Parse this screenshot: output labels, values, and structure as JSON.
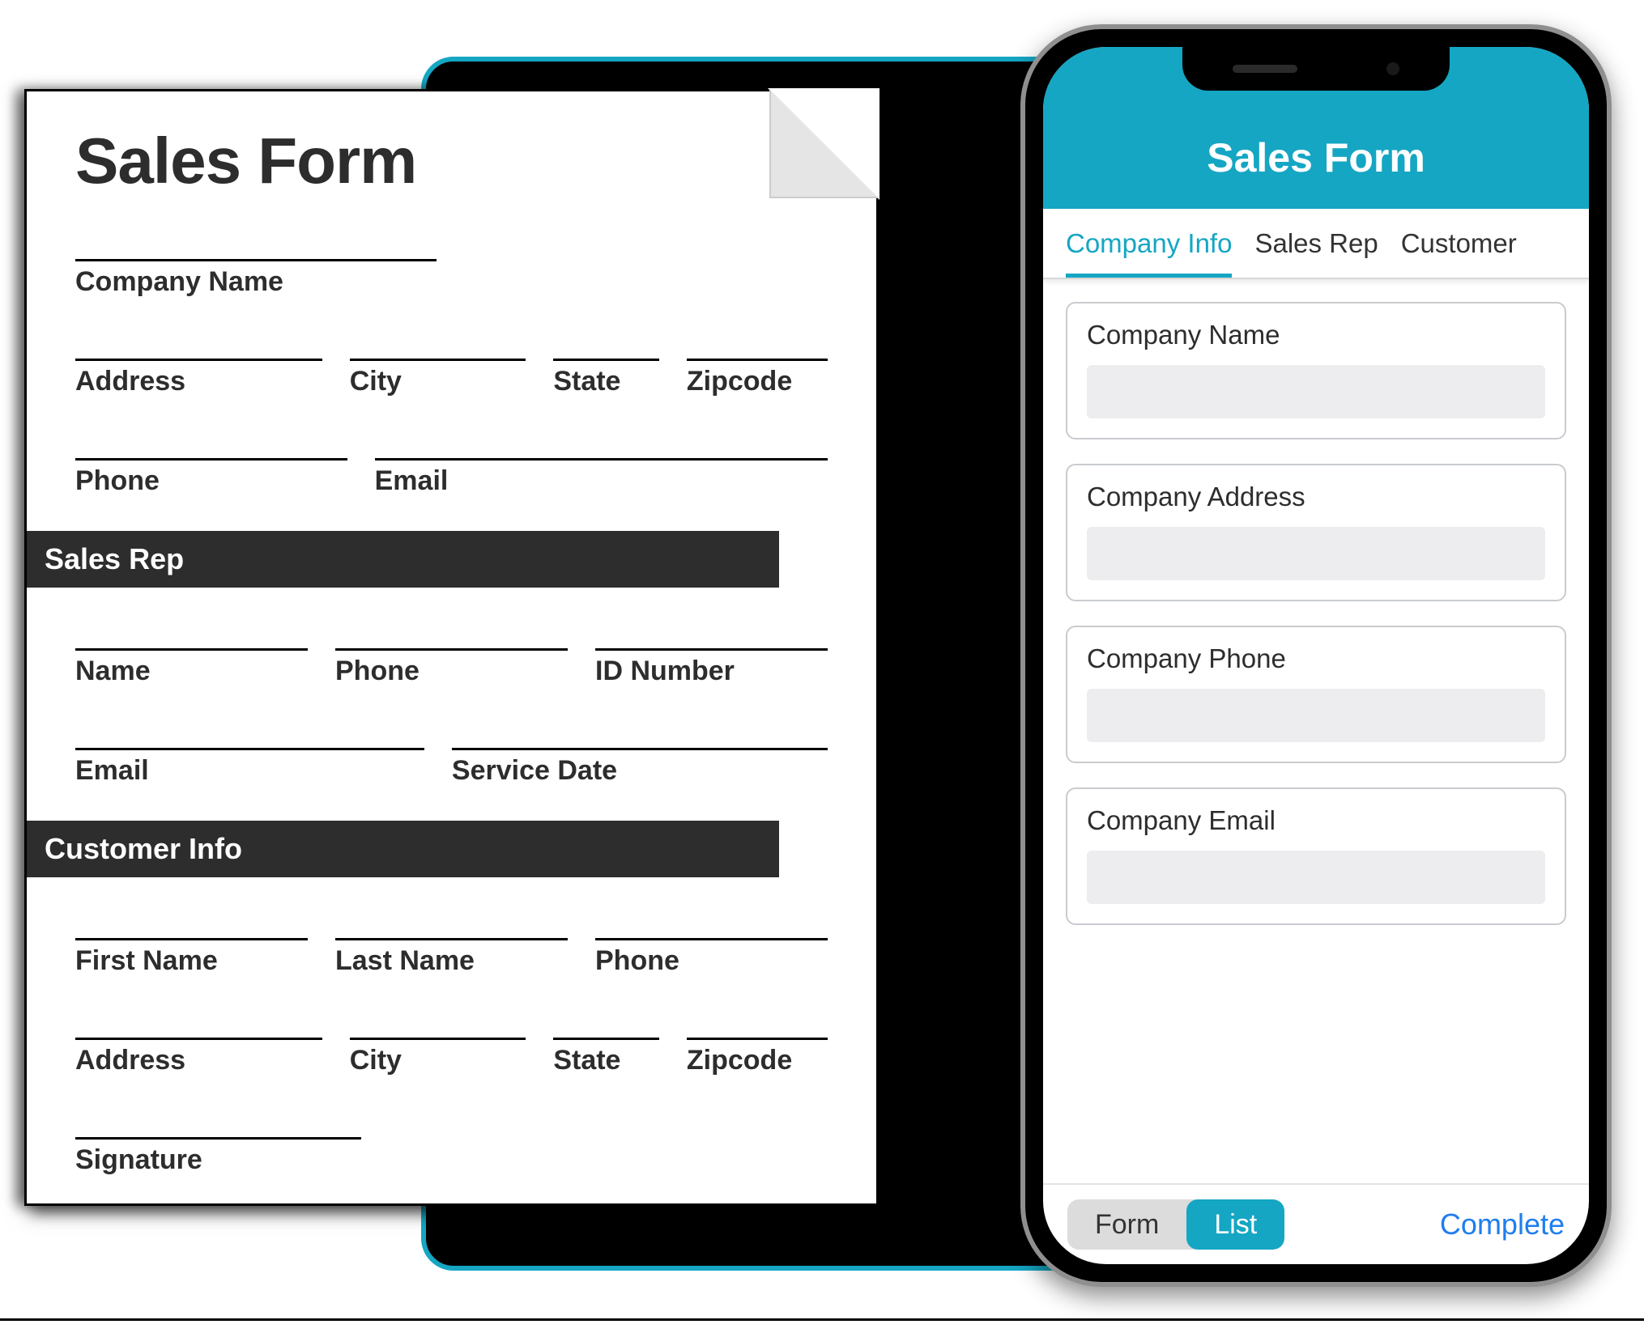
{
  "colors": {
    "accent": "#15a6c3",
    "ink": "#2d2d2d",
    "link": "#1e7ef0"
  },
  "paper": {
    "title": "Sales Form",
    "company_fields": {
      "company_name": "Company Name",
      "address": "Address",
      "city": "City",
      "state": "State",
      "zipcode": "Zipcode",
      "phone": "Phone",
      "email": "Email"
    },
    "section_sales_rep": "Sales Rep",
    "sales_rep_fields": {
      "name": "Name",
      "phone": "Phone",
      "id_number": "ID Number",
      "email": "Email",
      "service_date": "Service Date"
    },
    "section_customer": "Customer Info",
    "customer_fields": {
      "first_name": "First Name",
      "last_name": "Last Name",
      "phone": "Phone",
      "address": "Address",
      "city": "City",
      "state": "State",
      "zipcode": "Zipcode",
      "signature": "Signature"
    }
  },
  "phone": {
    "title": "Sales Form",
    "tabs": {
      "company_info": "Company Info",
      "sales_rep": "Sales Rep",
      "customer": "Customer"
    },
    "fields": {
      "company_name": "Company Name",
      "company_address": "Company Address",
      "company_phone": "Company Phone",
      "company_email": "Company Email"
    },
    "bottom": {
      "form": "Form",
      "list": "List",
      "complete": "Complete"
    }
  }
}
